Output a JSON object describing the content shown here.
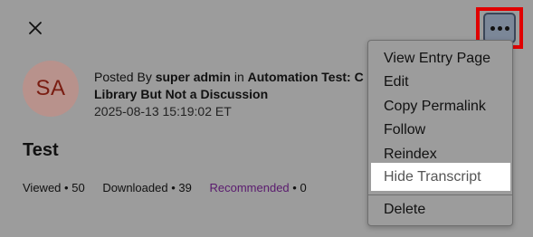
{
  "header": {
    "close_icon": "close-icon",
    "more_icon": "more-horizontal-icon"
  },
  "post": {
    "avatar_initials": "SA",
    "posted_by_prefix": "Posted By ",
    "author": "super admin",
    "in_text": " in ",
    "location_line1": "Automation Test: C",
    "location_line2": "Library But Not a Discussion",
    "timestamp": "2025-08-13 15:19:02 ET",
    "title": "Test"
  },
  "stats": {
    "viewed_label": "Viewed",
    "viewed_count": "50",
    "downloaded_label": "Downloaded",
    "downloaded_count": "39",
    "recommended_label": "Recommended",
    "recommended_count": "0",
    "separator": "•"
  },
  "menu": {
    "items": [
      {
        "label": "View Entry Page"
      },
      {
        "label": "Edit"
      },
      {
        "label": "Copy Permalink"
      },
      {
        "label": "Follow"
      },
      {
        "label": "Reindex"
      },
      {
        "label": "Hide Transcript"
      },
      {
        "label": "Delete"
      }
    ]
  },
  "colors": {
    "overlay_bg": "#9c9c9c",
    "highlight": "#e00000",
    "avatar_bg": "#b8928c",
    "avatar_text": "#7a1d12",
    "recommended": "#5a1a6e"
  }
}
